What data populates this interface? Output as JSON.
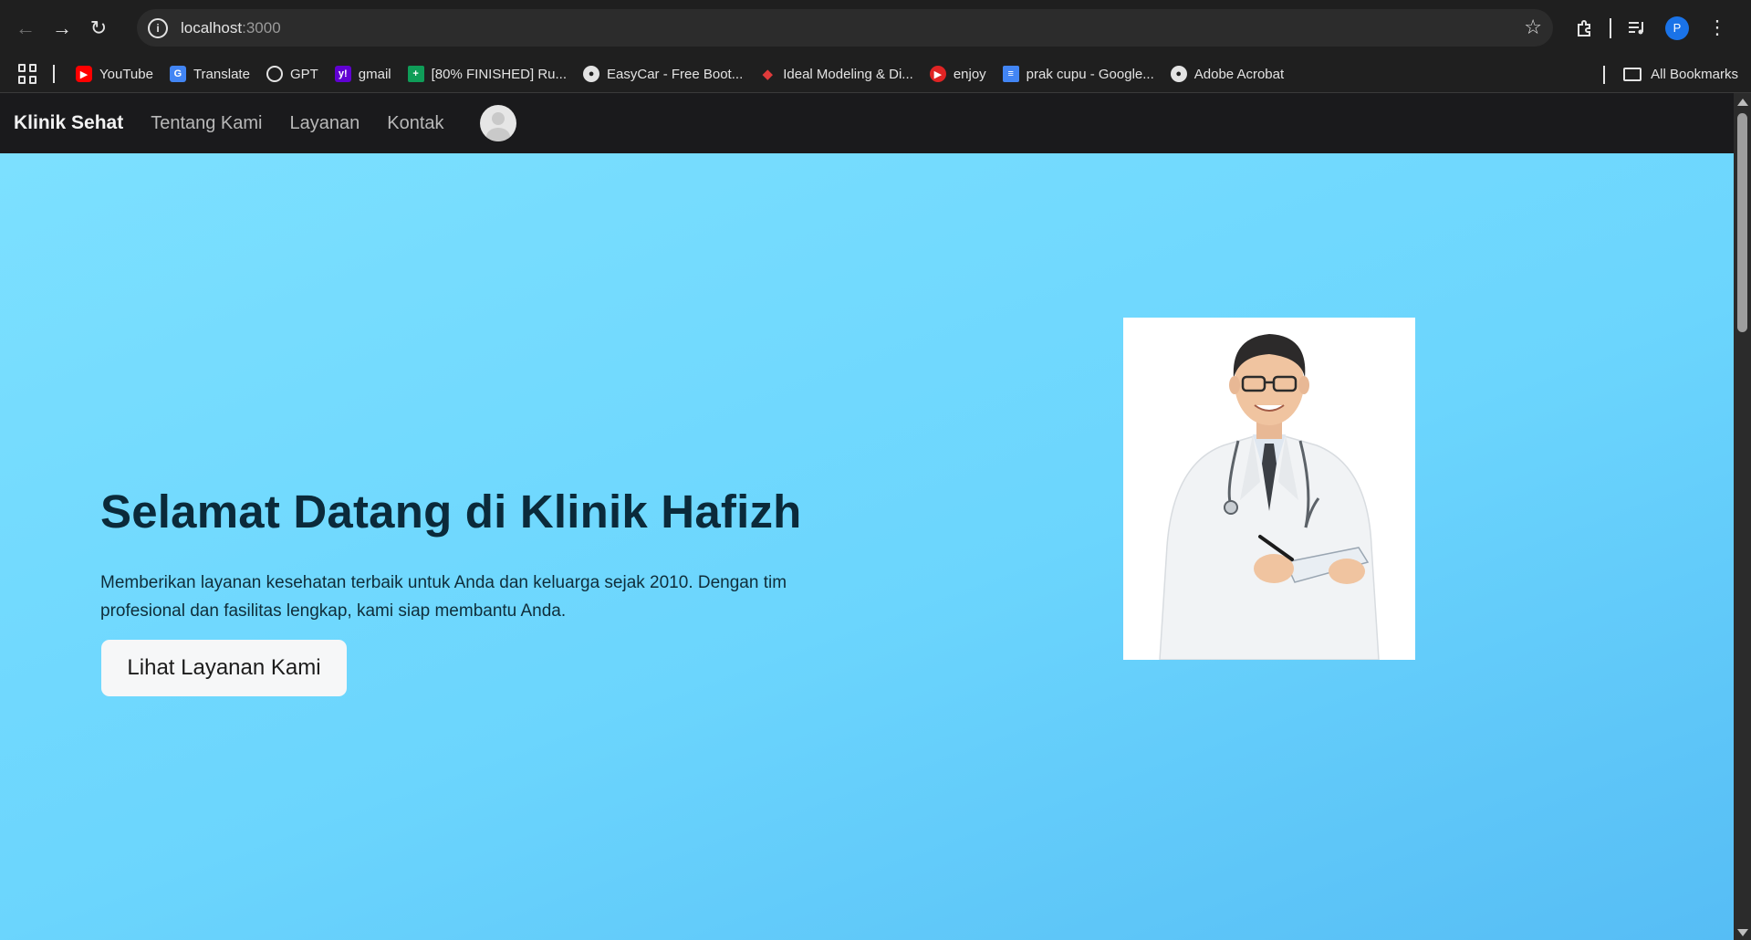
{
  "browser": {
    "url_host": "localhost",
    "url_port": ":3000",
    "profile_initial": "P",
    "bookmarks": [
      {
        "label": "YouTube",
        "icon": "youtube-icon"
      },
      {
        "label": "Translate",
        "icon": "translate-icon"
      },
      {
        "label": "GPT",
        "icon": "chatgpt-icon"
      },
      {
        "label": "gmail",
        "icon": "yahoo-icon"
      },
      {
        "label": "[80% FINISHED] Ru...",
        "icon": "sheets-icon"
      },
      {
        "label": "EasyCar - Free Boot...",
        "icon": "globe-icon"
      },
      {
        "label": "Ideal Modeling & Di...",
        "icon": "diamond-icon"
      },
      {
        "label": "enjoy",
        "icon": "play-icon"
      },
      {
        "label": "prak cupu - Google...",
        "icon": "docs-icon"
      },
      {
        "label": "Adobe Acrobat",
        "icon": "globe-icon"
      }
    ],
    "all_bookmarks_label": "All Bookmarks"
  },
  "site": {
    "brand": "Klinik Sehat",
    "nav_links": [
      "Tentang Kami",
      "Layanan",
      "Kontak"
    ]
  },
  "hero": {
    "title": "Selamat Datang di Klinik Hafizh",
    "text": "Memberikan layanan kesehatan terbaik untuk Anda dan keluarga sejak 2010. Dengan tim profesional dan fasilitas lengkap, kami siap membantu Anda.",
    "button_label": "Lihat Layanan Kami"
  },
  "colors": {
    "hero_gradient_start": "#7ce0ff",
    "hero_gradient_end": "#56bdf5",
    "navbar_bg": "#1a1a1c",
    "title_color": "#0b2a3a"
  }
}
